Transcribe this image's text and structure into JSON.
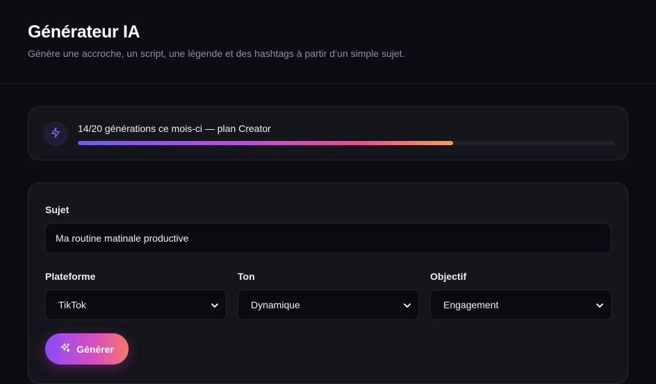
{
  "header": {
    "title": "Générateur IA",
    "subtitle": "Génère une accroche, un script, une légende et des hashtags à partir d’un simple sujet."
  },
  "usage": {
    "text": "14/20 générations ce mois-ci — plan Creator",
    "used": 14,
    "limit": 20,
    "icon": "lightning-icon",
    "accent": "#6d5cf6"
  },
  "form": {
    "subject_label": "Sujet",
    "subject_value": "Ma routine matinale productive",
    "platform_label": "Plateforme",
    "platform_value": "TikTok",
    "tone_label": "Ton",
    "tone_value": "Dynamique",
    "goal_label": "Objectif",
    "goal_value": "Engagement",
    "generate_label": "Générer",
    "generate_icon": "sparkles-icon"
  }
}
